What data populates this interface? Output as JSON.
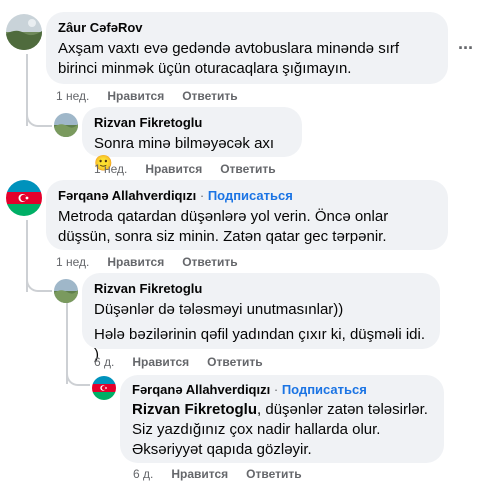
{
  "comments": [
    {
      "author": "Zâur CəfəRov",
      "text": "Axşam vaxtı evə gedəndə avtobuslara minəndə sırf birinci minmək üçün oturacaqlara şığımayın.",
      "time": "1 нед.",
      "like": "Нравится",
      "reply": "Ответить",
      "more_icon": "···"
    },
    {
      "author": "Rizvan Fikretoglu",
      "text": "Sonra minə bilməyəcək axı",
      "emoji": "🙂",
      "time": "1 нед.",
      "like": "Нравится",
      "reply": "Ответить"
    },
    {
      "author": "Fərqanə Allahverdiqızı",
      "dot": "·",
      "subscribe": "Подписаться",
      "text": "Metroda qatardan düşənlərə yol verin. Öncə onlar düşsün, sonra siz minin. Zatən qatar gec tərpənir.",
      "time": "1 нед.",
      "like": "Нравится",
      "reply": "Ответить"
    },
    {
      "author": "Rizvan Fikretoglu",
      "text1": "Düşənlər də tələsməyi unutmasınlar))",
      "text2": "Hələ bəzilərinin qəfil yadından çıxır ki, düşməli idi. )",
      "time": "6 д.",
      "like": "Нравится",
      "reply": "Ответить"
    },
    {
      "author": "Fərqanə Allahverdiqızı",
      "dot": "·",
      "subscribe": "Подписаться",
      "mention": "Rizvan Fikretoglu",
      "text": ", düşənlər zatən tələsirlər. Siz yazdığınız çox nadir hallarda olur. Əksəriyyət qapıda gözləyir.",
      "time": "6 д.",
      "like": "Нравится",
      "reply": "Ответить"
    }
  ],
  "colors": {
    "bubble": "#f0f2f5",
    "link": "#1b74e4",
    "meta": "#65676b",
    "thread_line": "#cdd0d4"
  }
}
